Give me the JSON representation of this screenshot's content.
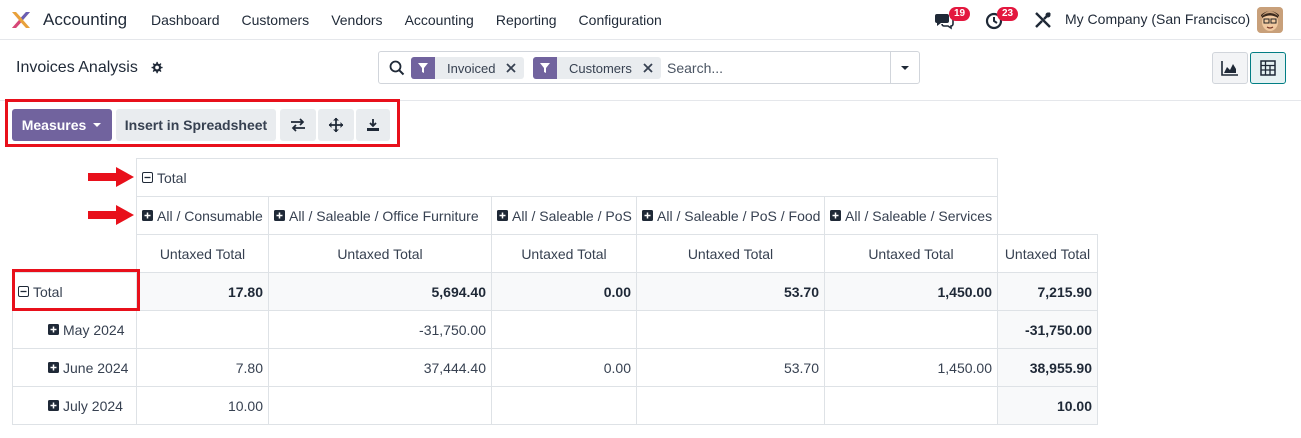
{
  "nav": {
    "app_name": "Accounting",
    "menu": [
      "Dashboard",
      "Customers",
      "Vendors",
      "Accounting",
      "Reporting",
      "Configuration"
    ],
    "messages_count": "19",
    "activities_count": "23",
    "company": "My Company (San Francisco)"
  },
  "control_panel": {
    "title": "Invoices Analysis",
    "facets": [
      "Invoiced",
      "Customers"
    ],
    "search_placeholder": "Search..."
  },
  "toolbar": {
    "measures_label": "Measures",
    "spreadsheet_label": "Insert in Spreadsheet"
  },
  "pivot": {
    "col_total_label": "Total",
    "col_groups": [
      "All / Consumable",
      "All / Saleable / Office Furniture",
      "All / Saleable / PoS",
      "All / Saleable / PoS / Food",
      "All / Saleable / Services"
    ],
    "measure_label": "Untaxed Total",
    "row_total_label": "Total",
    "rows": [
      {
        "label": "Total",
        "values": [
          "17.80",
          "5,694.40",
          "0.00",
          "53.70",
          "1,450.00",
          "7,215.90"
        ]
      },
      {
        "label": "May 2024",
        "values": [
          "",
          "-31,750.00",
          "",
          "",
          "",
          "-31,750.00"
        ]
      },
      {
        "label": "June 2024",
        "values": [
          "7.80",
          "37,444.40",
          "0.00",
          "53.70",
          "1,450.00",
          "38,955.90"
        ]
      },
      {
        "label": "July 2024",
        "values": [
          "10.00",
          "",
          "",
          "",
          "",
          "10.00"
        ]
      }
    ]
  },
  "colors": {
    "primary": "#71639e",
    "highlight": "#e8101b",
    "badge": "#e3173e"
  }
}
